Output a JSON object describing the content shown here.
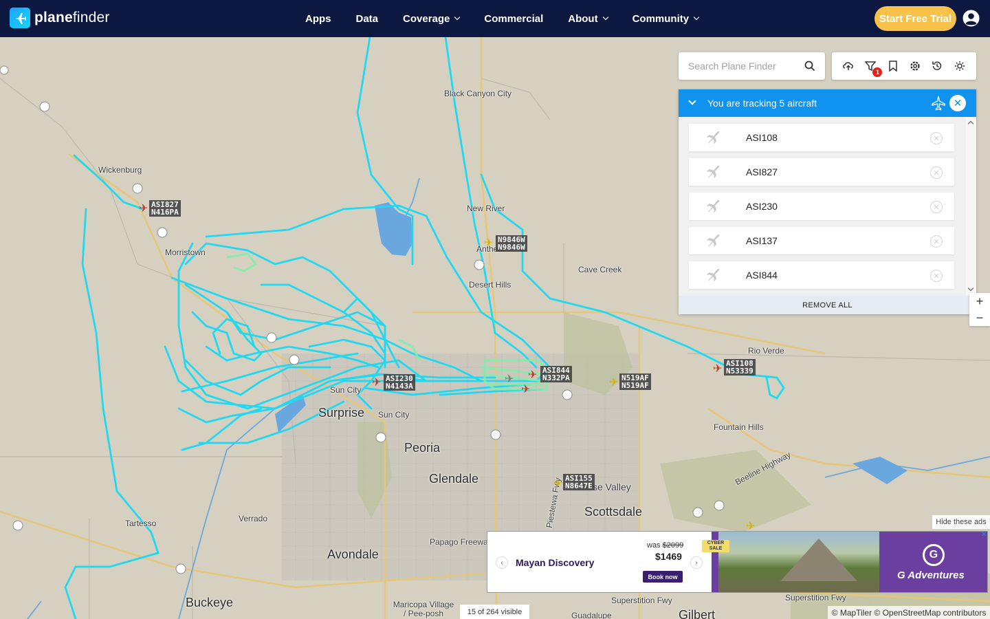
{
  "header": {
    "logo_bold": "plane",
    "logo_rest": "finder",
    "nav": [
      {
        "label": "Apps"
      },
      {
        "label": "Data"
      },
      {
        "label": "Coverage"
      },
      {
        "label": "Commercial"
      },
      {
        "label": "About"
      },
      {
        "label": "Community"
      }
    ],
    "trial_label": "Start Free Trial"
  },
  "search": {
    "placeholder": "Search Plane Finder"
  },
  "toolbar": {
    "filter_badge": "1"
  },
  "tracking": {
    "title": "You are tracking 5 aircraft",
    "items": [
      {
        "callsign": "ASI108"
      },
      {
        "callsign": "ASI827"
      },
      {
        "callsign": "ASI230"
      },
      {
        "callsign": "ASI137"
      },
      {
        "callsign": "ASI844"
      }
    ],
    "remove_all": "REMOVE ALL"
  },
  "map": {
    "cities": [
      {
        "name": "Black Canyon City"
      },
      {
        "name": "Wickenburg"
      },
      {
        "name": "New River"
      },
      {
        "name": "Morristown"
      },
      {
        "name": "Anthem"
      },
      {
        "name": "Cave Creek"
      },
      {
        "name": "Desert Hills"
      },
      {
        "name": "Rio Verde"
      },
      {
        "name": "Sun City"
      },
      {
        "name": "Surprise"
      },
      {
        "name": "Sun City"
      },
      {
        "name": "Fountain Hills"
      },
      {
        "name": "Peoria"
      },
      {
        "name": "Glendale"
      },
      {
        "name": "se Valley"
      },
      {
        "name": "Verrado"
      },
      {
        "name": "Scottsdale"
      },
      {
        "name": "Tartesso"
      },
      {
        "name": "Papago Freewa"
      },
      {
        "name": "Avondale"
      },
      {
        "name": "Buckeye"
      },
      {
        "name": "Maricopa Village / Pee-posh"
      },
      {
        "name": "Superstition Fwy"
      },
      {
        "name": "Superstition Fwy"
      },
      {
        "name": "Guadalupe"
      },
      {
        "name": "Gilbert"
      },
      {
        "name": "Beeline Highway"
      },
      {
        "name": "Piestewa Fwy"
      }
    ],
    "aircraft_labels": [
      {
        "line1": "ASI827",
        "line2": "N416PA"
      },
      {
        "line1": "N9846W",
        "line2": "N9846W"
      },
      {
        "line1": "ASI844",
        "line2": "N332PA"
      },
      {
        "line1": "N519AF",
        "line2": "N519AF"
      },
      {
        "line1": "ASI108",
        "line2": "N53339"
      },
      {
        "line1": "ASI230",
        "line2": "N4143A"
      },
      {
        "line1": "ASI155",
        "line2": "N8647E"
      }
    ],
    "visible_count": "15 of 264 visible",
    "attribution": "© MapTiler © OpenStreetMap contributors",
    "zoom_in": "+",
    "zoom_out": "−"
  },
  "ad": {
    "hide_label": "Hide these ads",
    "title": "Mayan Discovery",
    "was_prefix": "was ",
    "was_price": "$2099",
    "price": "$1469",
    "book": "Book now",
    "badge": "CYBER SALE",
    "brand": "G Adventures",
    "brand_mark": "G"
  },
  "colors": {
    "header": "#0d1841",
    "accent": "#0f93ef",
    "trial": "#f6c24a",
    "track": "#21d8f0",
    "track_green": "#7ef0a8"
  }
}
